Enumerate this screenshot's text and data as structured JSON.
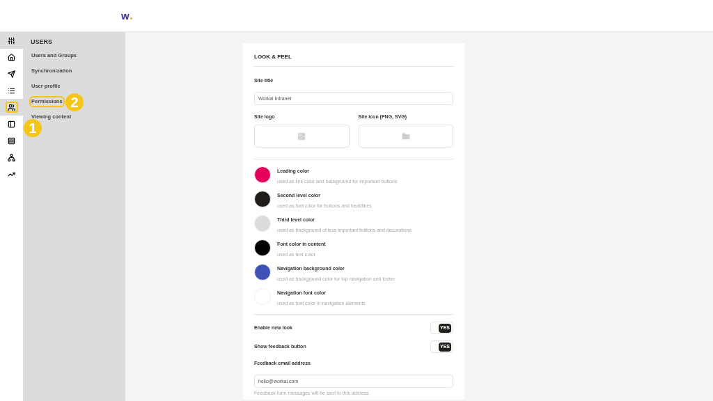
{
  "header": {
    "logo": "w"
  },
  "rail": [
    {
      "selected": true,
      "highlighted": false
    },
    {
      "selected": false,
      "highlighted": false
    },
    {
      "selected": false,
      "highlighted": false
    },
    {
      "selected": false,
      "highlighted": false
    },
    {
      "selected": true,
      "highlighted": true,
      "badge": "1"
    },
    {
      "selected": false,
      "highlighted": false
    },
    {
      "selected": false,
      "highlighted": false
    },
    {
      "selected": false,
      "highlighted": false
    },
    {
      "selected": false,
      "highlighted": false
    }
  ],
  "sidebar": {
    "heading": "USERS",
    "items": [
      {
        "label": "Users and Groups",
        "highlighted": false
      },
      {
        "label": "Synchronization",
        "highlighted": false
      },
      {
        "label": "User profile",
        "highlighted": false
      },
      {
        "label": "Permissions",
        "highlighted": true,
        "badge": "2"
      },
      {
        "label": "Viewing content",
        "highlighted": false
      }
    ]
  },
  "card": {
    "title": "LOOK & FEEL",
    "site_title": {
      "label": "Site title",
      "value": "Workai Intranet"
    },
    "uploads": [
      {
        "label": "Site logo",
        "kind": "image"
      },
      {
        "label": "Site icon (PNG, SVG)",
        "kind": "folder"
      }
    ],
    "colors": [
      {
        "name": "Leading color",
        "hint": "used as link color and background for important buttons",
        "color": "#e5005a"
      },
      {
        "name": "Second level color",
        "hint": "used as font color for buttons and headlines",
        "color": "#211d19"
      },
      {
        "name": "Third level color",
        "hint": "used as background of less important buttons and decorations",
        "color": "#dcdcdc"
      },
      {
        "name": "Font color in content",
        "hint": "used as text color",
        "color": "#000000"
      },
      {
        "name": "Navigation background color",
        "hint": "used as background color for top navigation and footer",
        "color": "#3f51b5"
      },
      {
        "name": "Navigation font color",
        "hint": "used as font color in navigation elements",
        "color": "#ffffff"
      }
    ],
    "toggles": [
      {
        "label": "Enable new look",
        "on": true,
        "text": "YES"
      },
      {
        "label": "Show feedback button",
        "on": true,
        "text": "YES"
      }
    ],
    "email": {
      "label": "Feedback email address",
      "value": "hello@workai.com",
      "hint": "Feedback form messages will be sent to this address"
    }
  }
}
